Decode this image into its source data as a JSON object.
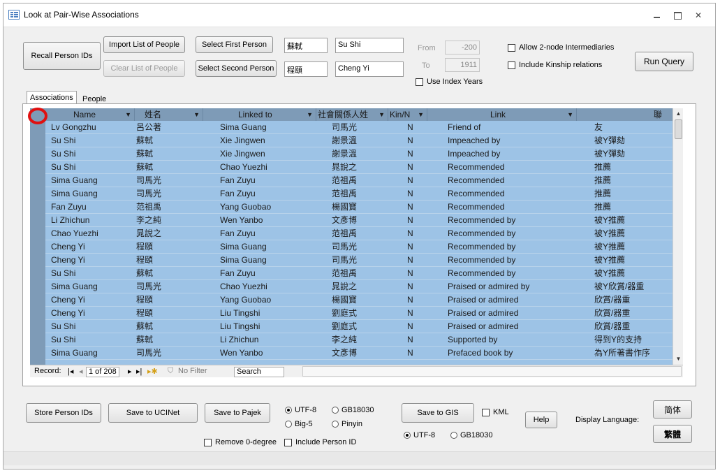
{
  "window": {
    "title": "Look at Pair-Wise Associations"
  },
  "toolbar": {
    "recall_person_ids": "Recall Person IDs",
    "import_list": "Import List of People",
    "clear_list": "Clear List of People",
    "select_first": "Select First Person",
    "select_second": "Select Second Person",
    "first_chinese": "蘇軾",
    "first_name": "Su Shi",
    "second_chinese": "程頤",
    "second_name": "Cheng Yi",
    "from_label": "From",
    "from_value": "-200",
    "to_label": "To",
    "to_value": "1911",
    "use_index_years": "Use Index Years",
    "allow_intermediaries": "Allow 2-node Intermediaries",
    "include_kinship": "Include Kinship relations",
    "run_query": "Run Query"
  },
  "tabs": [
    "Associations",
    "People"
  ],
  "grid": {
    "columns": [
      "Name",
      "姓名",
      "Linked to",
      "社會關係人姓",
      "Kin/N",
      "Link",
      "聯"
    ],
    "rows": [
      [
        "Lv Gongzhu",
        "呂公著",
        "Sima Guang",
        "司馬光",
        "N",
        "Friend of",
        "友"
      ],
      [
        "Su Shi",
        "蘇軾",
        "Xie Jingwen",
        "謝景溫",
        "N",
        "Impeached by",
        "被Y彈劾"
      ],
      [
        "Su Shi",
        "蘇軾",
        "Xie Jingwen",
        "謝景溫",
        "N",
        "Impeached by",
        "被Y彈劾"
      ],
      [
        "Su Shi",
        "蘇軾",
        "Chao Yuezhi",
        "晁說之",
        "N",
        "Recommended",
        "推薦"
      ],
      [
        "Sima Guang",
        "司馬光",
        "Fan Zuyu",
        "范祖禹",
        "N",
        "Recommended",
        "推薦"
      ],
      [
        "Sima Guang",
        "司馬光",
        "Fan Zuyu",
        "范祖禹",
        "N",
        "Recommended",
        "推薦"
      ],
      [
        "Fan Zuyu",
        "范祖禹",
        "Yang Guobao",
        "楊國寶",
        "N",
        "Recommended",
        "推薦"
      ],
      [
        "Li Zhichun",
        "李之純",
        "Wen Yanbo",
        "文彥博",
        "N",
        "Recommended by",
        "被Y推薦"
      ],
      [
        "Chao Yuezhi",
        "晁說之",
        "Fan Zuyu",
        "范祖禹",
        "N",
        "Recommended by",
        "被Y推薦"
      ],
      [
        "Cheng Yi",
        "程頤",
        "Sima Guang",
        "司馬光",
        "N",
        "Recommended by",
        "被Y推薦"
      ],
      [
        "Cheng Yi",
        "程頤",
        "Sima Guang",
        "司馬光",
        "N",
        "Recommended by",
        "被Y推薦"
      ],
      [
        "Su Shi",
        "蘇軾",
        "Fan Zuyu",
        "范祖禹",
        "N",
        "Recommended by",
        "被Y推薦"
      ],
      [
        "Sima Guang",
        "司馬光",
        "Chao Yuezhi",
        "晁說之",
        "N",
        "Praised or admired by",
        "被Y欣賞/器重"
      ],
      [
        "Cheng Yi",
        "程頤",
        "Yang Guobao",
        "楊國寶",
        "N",
        "Praised or admired",
        "欣賞/器重"
      ],
      [
        "Cheng Yi",
        "程頤",
        "Liu Tingshi",
        "劉庭式",
        "N",
        "Praised or admired",
        "欣賞/器重"
      ],
      [
        "Su Shi",
        "蘇軾",
        "Liu Tingshi",
        "劉庭式",
        "N",
        "Praised or admired",
        "欣賞/器重"
      ],
      [
        "Su Shi",
        "蘇軾",
        "Li Zhichun",
        "李之純",
        "N",
        "Supported by",
        "得到Y的支持"
      ],
      [
        "Sima Guang",
        "司馬光",
        "Wen Yanbo",
        "文彥博",
        "N",
        "Prefaced book by",
        "為Y所著書作序"
      ]
    ]
  },
  "navigator": {
    "record_label": "Record:",
    "record_position": "1 of 208",
    "filter": "No Filter",
    "search_placeholder": "Search"
  },
  "bottom": {
    "store_ids": "Store Person IDs",
    "save_ucinet": "Save to UCINet",
    "save_pajek": "Save to Pajek",
    "utf8": "UTF-8",
    "gb18030": "GB18030",
    "big5": "Big-5",
    "pinyin": "Pinyin",
    "remove_zero": "Remove 0-degree",
    "include_person_id": "Include Person ID",
    "save_gis": "Save to GIS",
    "kml": "KML",
    "gis_utf8": "UTF-8",
    "gis_gb18030": "GB18030",
    "help": "Help",
    "display_language": "Display Language:",
    "simplified": "简体",
    "traditional": "繁體"
  },
  "colors": {
    "grid_bg": "#9dc3e6",
    "grid_header": "#7e9bb7",
    "annotation": "#e01010"
  }
}
